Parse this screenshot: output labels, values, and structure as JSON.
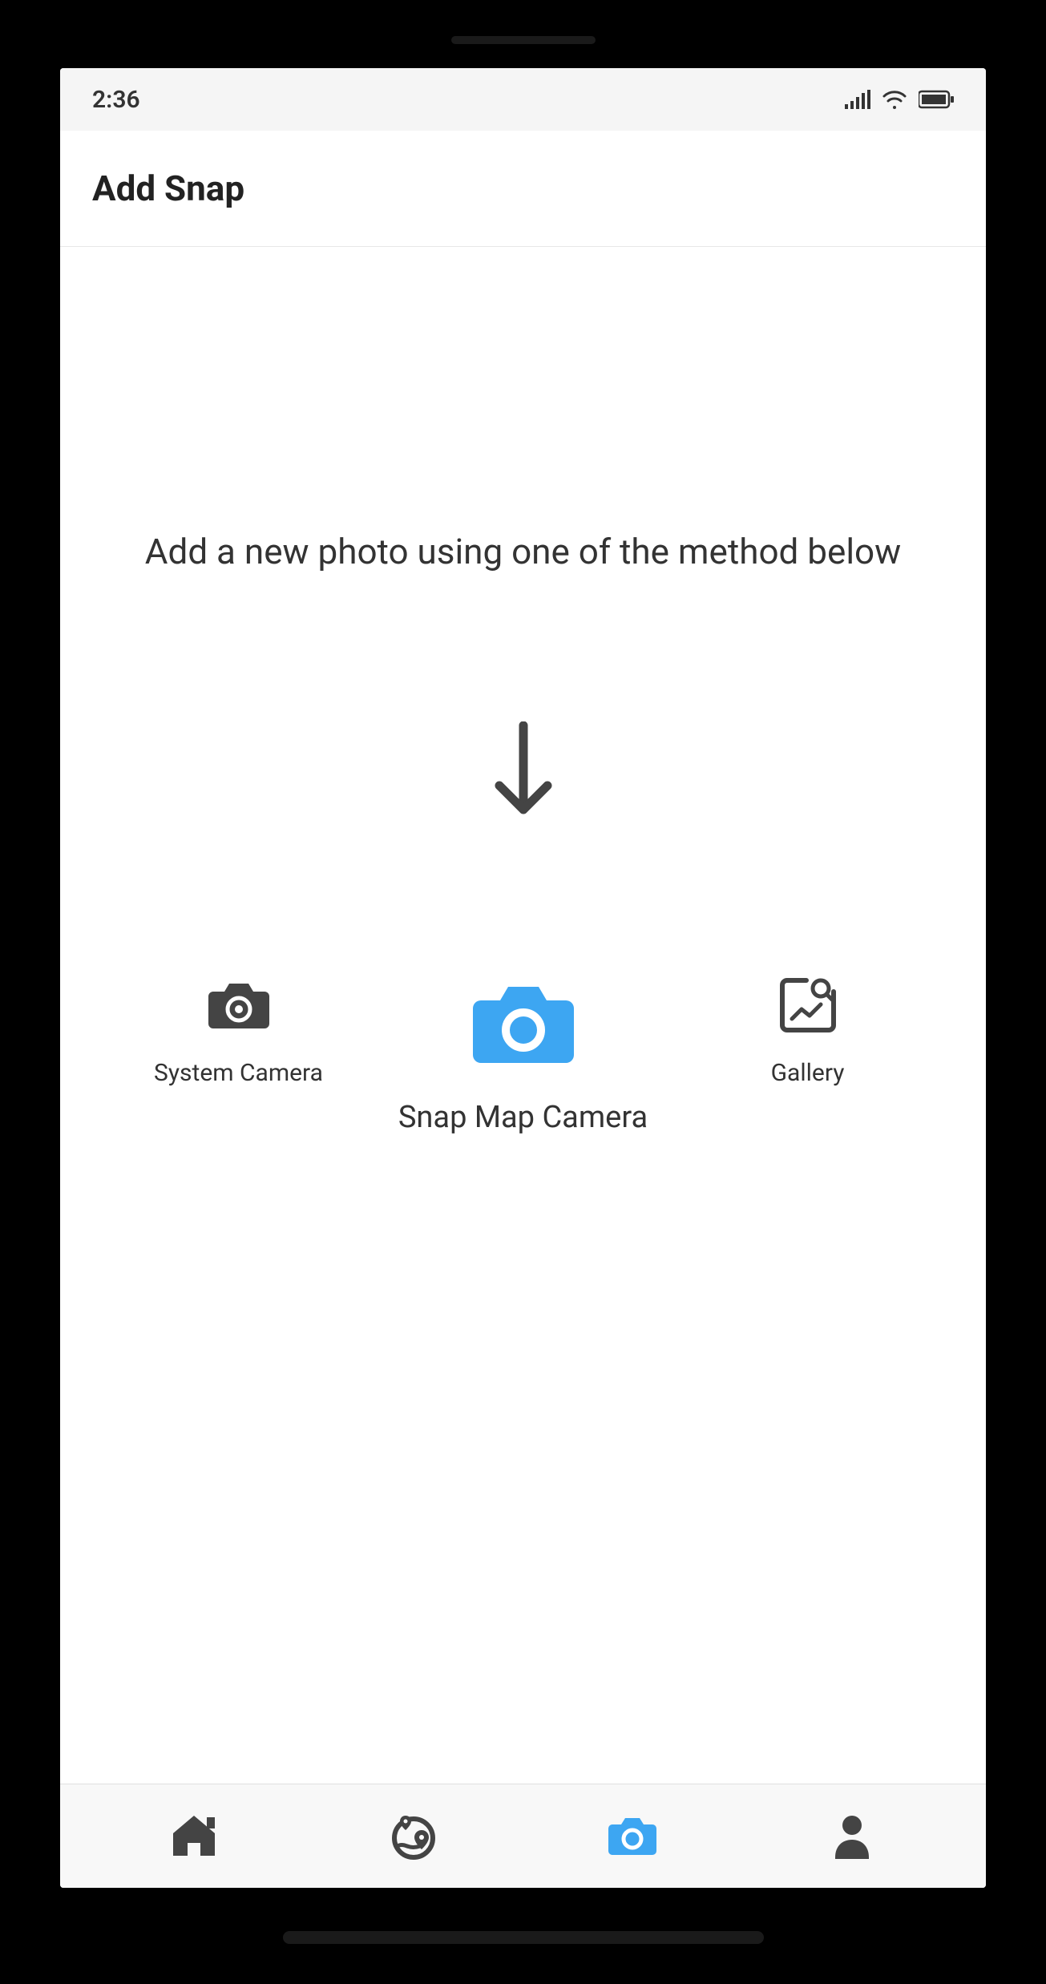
{
  "status": {
    "time": "2:36"
  },
  "header": {
    "title": "Add Snap"
  },
  "content": {
    "instruction": "Add a new photo using one of the method below",
    "options": {
      "systemCamera": "System Camera",
      "snapMapCamera": "Snap Map Camera",
      "gallery": "Gallery"
    }
  },
  "nav": {
    "home": "home",
    "map": "map",
    "camera": "camera",
    "profile": "profile"
  },
  "colors": {
    "accent": "#3DA6F2",
    "darkGray": "#444",
    "lightGray": "#f5f5f5"
  }
}
